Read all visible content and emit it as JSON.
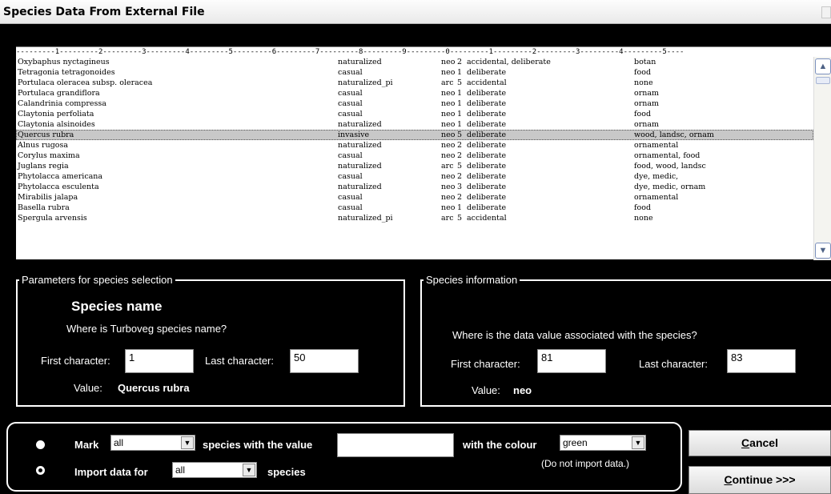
{
  "window": {
    "title": "Species Data From External File"
  },
  "file_list": {
    "ruler": "---------1---------2---------3---------4---------5---------6---------7---------8---------9---------0---------1---------2---------3---------4---------5----",
    "rows": [
      [
        "Oxybaphus nyctagineus",
        "naturalized",
        "neo",
        "2",
        "accidental, deliberate",
        "botan"
      ],
      [
        "Tetragonia tetragonoides",
        "casual",
        "neo",
        "1",
        "deliberate",
        "food"
      ],
      [
        "Portulaca oleracea subsp. oleracea",
        "naturalized_pi",
        "arc",
        "5",
        "accidental",
        "none"
      ],
      [
        "Portulaca grandiflora",
        "casual",
        "neo",
        "1",
        "deliberate",
        "ornam"
      ],
      [
        "Calandrinia compressa",
        "casual",
        "neo",
        "1",
        "deliberate",
        "ornam"
      ],
      [
        "Claytonia perfoliata",
        "casual",
        "neo",
        "1",
        "deliberate",
        "food"
      ],
      [
        "Claytonia alsinoides",
        "naturalized",
        "neo",
        "1",
        "deliberate",
        "ornam"
      ],
      [
        "Quercus rubra",
        "invasive",
        "neo",
        "5",
        "deliberate",
        "wood, landsc, ornam"
      ],
      [
        "Alnus rugosa",
        "naturalized",
        "neo",
        "2",
        "deliberate",
        "ornamental"
      ],
      [
        "Corylus maxima",
        "casual",
        "neo",
        "2",
        "deliberate",
        "ornamental, food"
      ],
      [
        "Juglans regia",
        "naturalized",
        "arc",
        "5",
        "deliberate",
        "food, wood, landsc"
      ],
      [
        "Phytolacca americana",
        "casual",
        "neo",
        "2",
        "deliberate",
        "dye, medic,"
      ],
      [
        "Phytolacca esculenta",
        "naturalized",
        "neo",
        "3",
        "deliberate",
        "dye, medic, ornam"
      ],
      [
        "Mirabilis jalapa",
        "casual",
        "neo",
        "2",
        "deliberate",
        "ornamental"
      ],
      [
        "Basella rubra",
        "casual",
        "neo",
        "1",
        "deliberate",
        "food"
      ],
      [
        "Spergula arvensis",
        "naturalized_pi",
        "arc",
        "5",
        "accidental",
        "none"
      ]
    ],
    "selected_index": 7
  },
  "species_params": {
    "legend": "Parameters for species selection",
    "heading": "Species name",
    "question": "Where is Turboveg species name?",
    "first_label": "First character:",
    "first_value": "1",
    "last_label": "Last character:",
    "last_value": "50",
    "value_label": "Value:",
    "value": "Quercus rubra"
  },
  "species_info": {
    "legend": "Species information",
    "question": "Where is the data value associated with the species?",
    "first_label": "First character:",
    "first_value": "81",
    "last_label": "Last character:",
    "last_value": "83",
    "value_label": "Value:",
    "value": "neo"
  },
  "options": {
    "mark_label": "Mark",
    "mark_select": "all",
    "species_with_value_label": "species with the value",
    "value_input": "",
    "with_colour_label": "with the colour",
    "colour_select": "green",
    "note": "(Do not import data.)",
    "import_label": "Import data for",
    "import_select": "all",
    "species_label": "species",
    "selected_option": "import"
  },
  "buttons": {
    "cancel_key": "C",
    "cancel_rest": "ancel",
    "continue_key": "C",
    "continue_rest": "ontinue >>>"
  }
}
